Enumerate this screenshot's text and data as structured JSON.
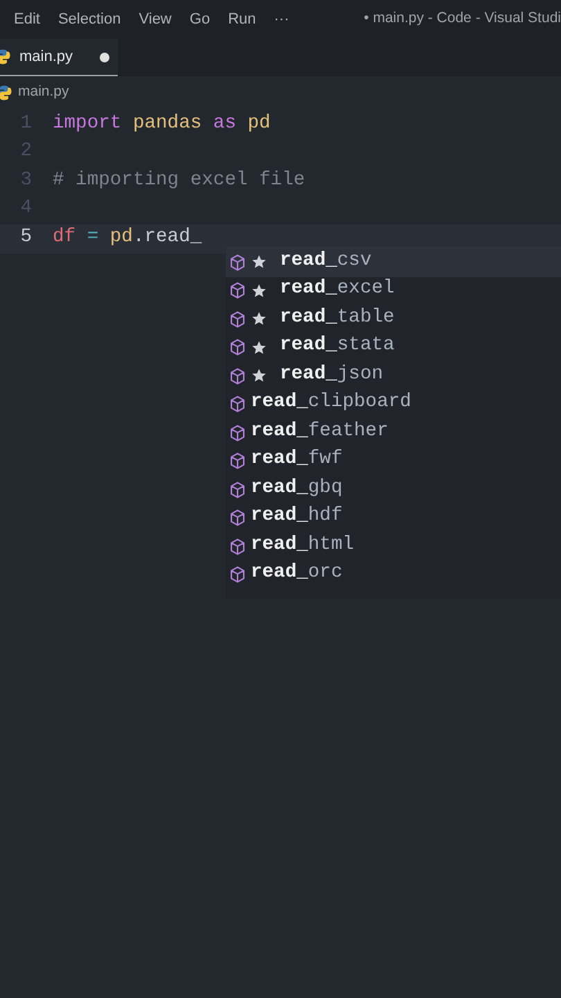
{
  "menu": [
    "Edit",
    "Selection",
    "View",
    "Go",
    "Run",
    "···"
  ],
  "window": {
    "title": "• main.py - Code - Visual Studi"
  },
  "tabs": [
    {
      "label": "main.py",
      "selected": true,
      "modified": true
    }
  ],
  "breadcrumb": "main.py",
  "editor": {
    "lines": [
      {
        "number": "1",
        "active": false,
        "tokens": [
          {
            "kind": "keyword",
            "text": "import"
          },
          {
            "kind": "module",
            "text": " pandas"
          },
          {
            "kind": "keyword",
            "text": " as"
          },
          {
            "kind": "module",
            "text": " pd"
          }
        ]
      },
      {
        "number": "2",
        "active": false
      },
      {
        "number": "3",
        "active": false,
        "tokens": [
          {
            "kind": "comment",
            "text": "# importing excel file"
          }
        ]
      },
      {
        "number": "4",
        "active": false
      },
      {
        "number": "5",
        "active": true,
        "tokens": [
          {
            "kind": "variable",
            "text": "df"
          },
          {
            "kind": "operator",
            "text": " ="
          },
          {
            "kind": "module",
            "text": " pd"
          },
          {
            "kind": "plain",
            "text": ".read_"
          }
        ]
      }
    ]
  },
  "suggestions": [
    {
      "label": "**read_**csv",
      "starred": true,
      "selected": true
    },
    {
      "label": "**read_**excel",
      "starred": true,
      "selected": false
    },
    {
      "label": "**read_**table",
      "starred": true,
      "selected": false
    },
    {
      "label": "**read_**stata",
      "starred": true,
      "selected": false
    },
    {
      "label": "**read_**json",
      "starred": true,
      "selected": false
    },
    {
      "label": "**read_**clipboard",
      "starred": false,
      "selected": false
    },
    {
      "label": "**read_**feather",
      "starred": false,
      "selected": false
    },
    {
      "label": "**read_**fwf",
      "starred": false,
      "selected": false
    },
    {
      "label": "**read_**gbq",
      "starred": false,
      "selected": false
    },
    {
      "label": "**read_**hdf",
      "starred": false,
      "selected": false
    },
    {
      "label": "**read_**html",
      "starred": false,
      "selected": false
    },
    {
      "label": "**read_**orc",
      "starred": false,
      "selected": false
    }
  ]
}
